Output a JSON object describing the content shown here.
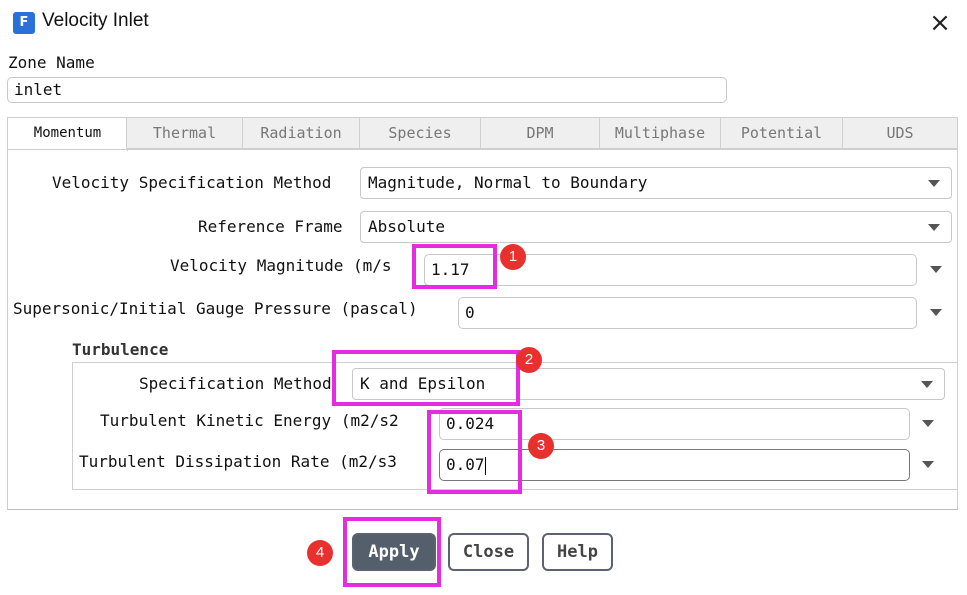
{
  "window": {
    "title": "Velocity Inlet",
    "app_icon_letter": "F",
    "close_symbol": "×"
  },
  "zone": {
    "label": "Zone Name",
    "value": "inlet"
  },
  "tabs": [
    {
      "label": "Momentum",
      "active": true
    },
    {
      "label": "Thermal",
      "active": false
    },
    {
      "label": "Radiation",
      "active": false
    },
    {
      "label": "Species",
      "active": false
    },
    {
      "label": "DPM",
      "active": false
    },
    {
      "label": "Multiphase",
      "active": false
    },
    {
      "label": "Potential",
      "active": false
    },
    {
      "label": "UDS",
      "active": false
    }
  ],
  "momentum": {
    "velocity_spec_label": "Velocity Specification Method",
    "velocity_spec_value": "Magnitude, Normal to Boundary",
    "reference_frame_label": "Reference Frame",
    "reference_frame_value": "Absolute",
    "velocity_magnitude_label": "Velocity Magnitude (m/s",
    "velocity_magnitude_value": "1.17",
    "gauge_pressure_label": "Supersonic/Initial Gauge Pressure (pascal)",
    "gauge_pressure_value": "0"
  },
  "turbulence": {
    "heading": "Turbulence",
    "spec_method_label": "Specification Method",
    "spec_method_value": "K and Epsilon",
    "tke_label": "Turbulent Kinetic Energy (m2/s2",
    "tke_value": "0.024",
    "tdr_label": "Turbulent Dissipation Rate (m2/s3",
    "tdr_value": "0.07"
  },
  "buttons": {
    "apply": "Apply",
    "close": "Close",
    "help": "Help"
  },
  "annotations": {
    "step1": "1",
    "step2": "2",
    "step3": "3",
    "step4": "4",
    "highlight_color": "#e52ce0",
    "badge_color": "#e8312f"
  }
}
